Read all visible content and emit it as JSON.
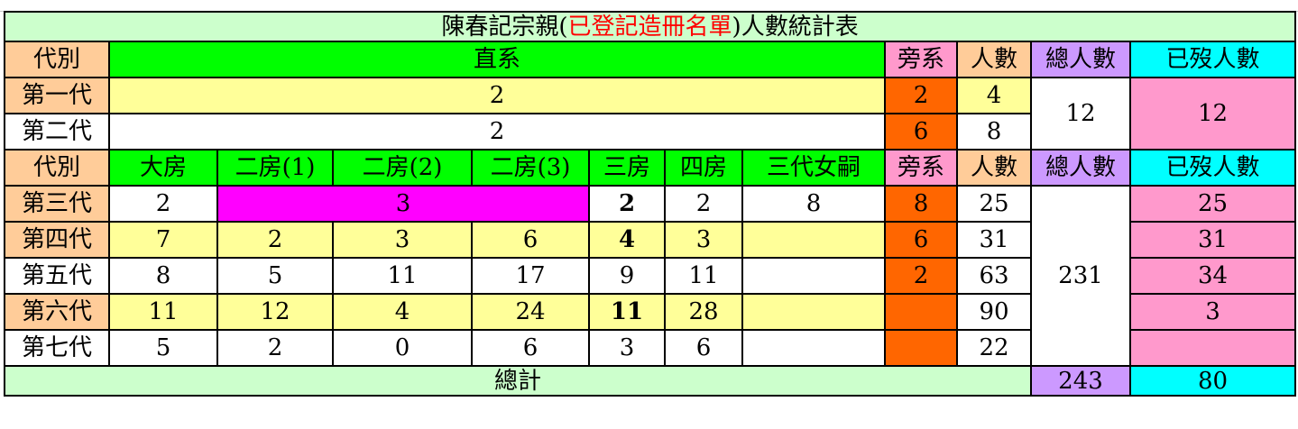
{
  "title": {
    "prefix": "陳春記宗親(",
    "highlight": "已登記造冊名單",
    "suffix": ")人數統計表"
  },
  "header1": {
    "generation": "代別",
    "direct": "直系",
    "collateral": "旁系",
    "count": "人數",
    "total": "總人數",
    "deceased": "已歿人數"
  },
  "header2": {
    "generation": "代別",
    "branches": [
      "大房",
      "二房(1)",
      "二房(2)",
      "二房(3)",
      "三房",
      "四房",
      "三代女嗣"
    ],
    "collateral": "旁系",
    "count": "人數",
    "total": "總人數",
    "deceased": "已歿人數"
  },
  "gen1": {
    "label": "第一代",
    "direct": "2",
    "collateral": "2",
    "count": "4"
  },
  "gen2": {
    "label": "第二代",
    "direct": "2",
    "collateral": "6",
    "count": "8"
  },
  "top_group": {
    "total": "12",
    "deceased": "12"
  },
  "gen3": {
    "label": "第三代",
    "branch1": "2",
    "branch2_merged": "3",
    "branch5": "2",
    "branch6": "2",
    "branch7": "8",
    "collateral": "8",
    "count": "25",
    "deceased": "25"
  },
  "gen4": {
    "label": "第四代",
    "cells": [
      "7",
      "2",
      "3",
      "6",
      "4",
      "3",
      ""
    ],
    "collateral": "6",
    "count": "31",
    "deceased": "31"
  },
  "gen5": {
    "label": "第五代",
    "cells": [
      "8",
      "5",
      "11",
      "17",
      "9",
      "11",
      ""
    ],
    "collateral": "2",
    "count": "63",
    "deceased": "34"
  },
  "gen6": {
    "label": "第六代",
    "cells": [
      "11",
      "12",
      "4",
      "24",
      "11",
      "28",
      ""
    ],
    "collateral": "",
    "count": "90",
    "deceased": "3"
  },
  "gen7": {
    "label": "第七代",
    "cells": [
      "5",
      "2",
      "0",
      "6",
      "3",
      "6",
      ""
    ],
    "collateral": "",
    "count": "22",
    "deceased": ""
  },
  "bottom_group": {
    "total": "231"
  },
  "summary": {
    "label": "總計",
    "total": "243",
    "deceased": "80"
  }
}
